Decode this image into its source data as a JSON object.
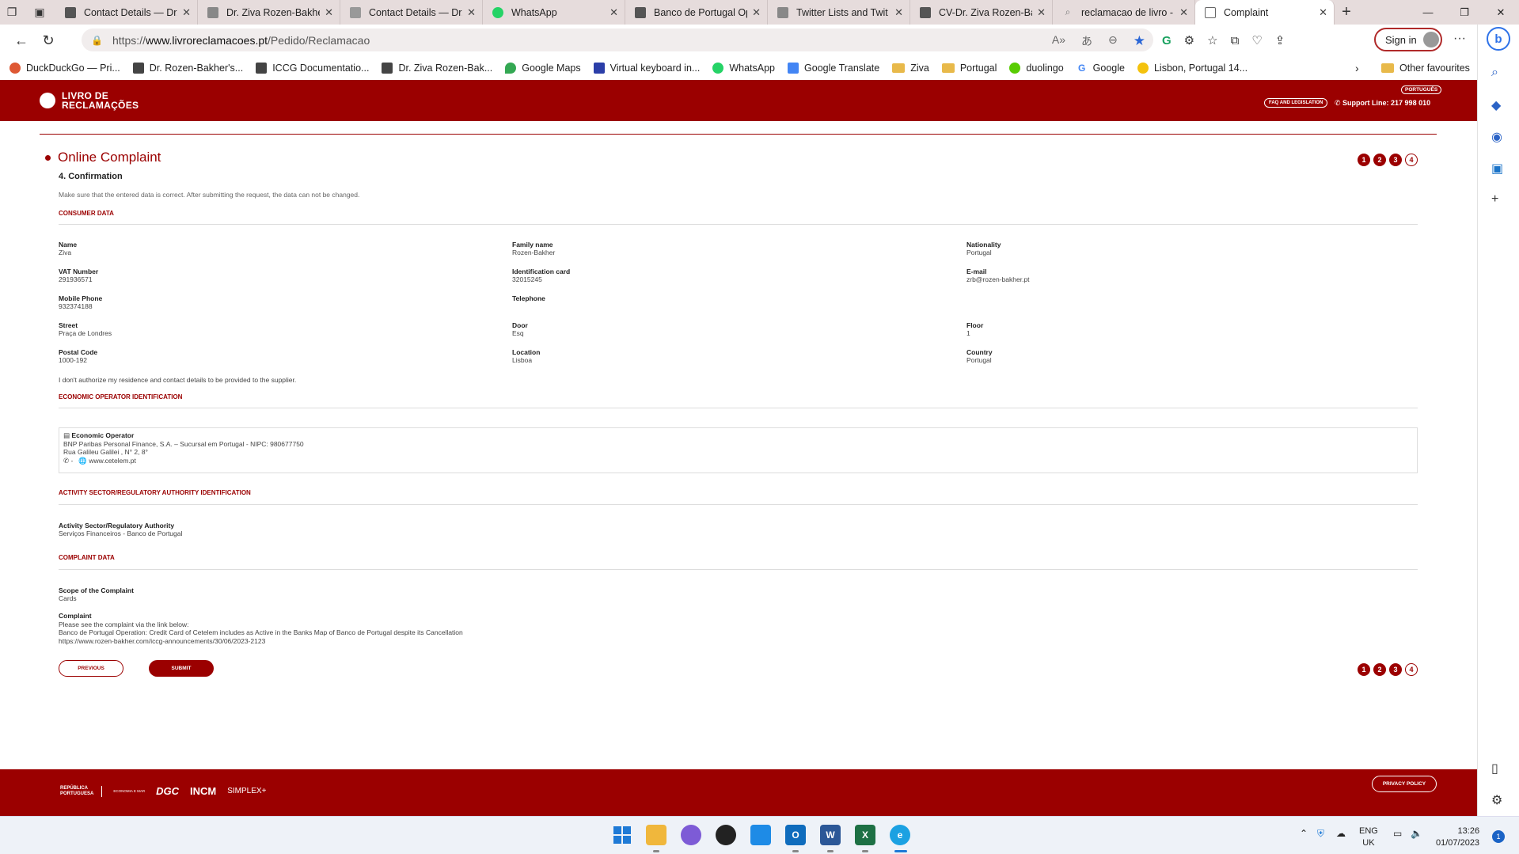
{
  "browser": {
    "tabs": [
      {
        "title": "Contact Details — Dr.",
        "active": false
      },
      {
        "title": "Dr. Ziva Rozen-Bakhe",
        "active": false
      },
      {
        "title": "Contact Details — Dr.",
        "active": false
      },
      {
        "title": "WhatsApp",
        "active": false
      },
      {
        "title": "Banco de Portugal Op",
        "active": false
      },
      {
        "title": "Twitter Lists and Twit",
        "active": false
      },
      {
        "title": "CV-Dr. Ziva Rozen-Ba",
        "active": false
      },
      {
        "title": "reclamacao de livro -",
        "active": false
      },
      {
        "title": "Complaint",
        "active": true
      }
    ],
    "url_prefix": "https://",
    "url_host": "www.livroreclamacoes.pt",
    "url_path": "/Pedido/Reclamacao",
    "sign_in": "Sign in",
    "favourites": [
      "DuckDuckGo — Pri...",
      "Dr. Rozen-Bakher's...",
      "ICCG Documentatio...",
      "Dr. Ziva Rozen-Bak...",
      "Google Maps",
      "Virtual keyboard in...",
      "WhatsApp",
      "Google Translate",
      "Ziva",
      "Portugal",
      "duolingo",
      "Google",
      "Lisbon, Portugal 14..."
    ],
    "other_favourites": "Other favourites"
  },
  "site": {
    "logo_line1": "LIVRO DE",
    "logo_line2": "RECLAMAÇÕES",
    "lang": "PORTUGUÊS",
    "faq": "FAQ AND LEGISLATION",
    "support": "Support Line: 217 998 010",
    "page_title": "Online Complaint",
    "step_title": "4. Confirmation",
    "steps": [
      "1",
      "2",
      "3",
      "4"
    ],
    "note": "Make sure that the entered data is correct. After submitting the request, the data can not be changed.",
    "consumer_header": "CONSUMER DATA",
    "consumer": {
      "name_l": "Name",
      "name_v": "Ziva",
      "family_l": "Family name",
      "family_v": "Rozen-Bakher",
      "nat_l": "Nationality",
      "nat_v": "Portugal",
      "vat_l": "VAT Number",
      "vat_v": "291936571",
      "id_l": "Identification card",
      "id_v": "32015245",
      "email_l": "E-mail",
      "email_v": "zrb@rozen-bakher.pt",
      "mobile_l": "Mobile Phone",
      "mobile_v": "932374188",
      "tel_l": "Telephone",
      "tel_v": "",
      "street_l": "Street",
      "street_v": "Praça de Londres",
      "door_l": "Door",
      "door_v": "Esq",
      "floor_l": "Floor",
      "floor_v": "1",
      "postal_l": "Postal Code",
      "postal_v": "1000-192",
      "loc_l": "Location",
      "loc_v": "Lisboa",
      "country_l": "Country",
      "country_v": "Portugal"
    },
    "consent": "I don't authorize my residence and contact details to be provided to the supplier.",
    "operator_header": "ECONOMIC OPERATOR IDENTIFICATION",
    "operator": {
      "label": "Economic Operator",
      "name": "BNP Paribas Personal Finance, S.A. – Sucursal em Portugal - NIPC: 980677750",
      "address": "Rua Galileu Galilei , N° 2, 8°",
      "phone": "-",
      "web": "www.cetelem.pt"
    },
    "sector_header": "ACTIVITY SECTOR/REGULATORY AUTHORITY IDENTIFICATION",
    "sector": {
      "label": "Activity Sector/Regulatory Authority",
      "value": "Serviços Financeiros - Banco de Portugal"
    },
    "complaint_header": "COMPLAINT DATA",
    "complaint": {
      "scope_l": "Scope of the Complaint",
      "scope_v": "Cards",
      "label": "Complaint",
      "line1": "Please see the complaint via the link below:",
      "line2": "Banco de Portugal Operation: Credit Card of Cetelem includes as Active in the Banks Map of Banco de Portugal despite its Cancellation",
      "line3": "https://www.rozen-bakher.com/iccg-announcements/30/06/2023-2123"
    },
    "btn_prev": "PREVIOUS",
    "btn_submit": "SUBMIT",
    "footer": {
      "rep1": "REPÚBLICA",
      "rep2": "PORTUGUESA",
      "econ": "ECONOMIA E MAR",
      "dgc": "DGC",
      "incm": "INCM",
      "simplex": "SIMPLEX+",
      "privacy": "PRIVACY POLICY"
    }
  },
  "taskbar": {
    "lang1": "ENG",
    "lang2": "UK",
    "time": "13:26",
    "date": "01/07/2023",
    "notifications": "1"
  }
}
